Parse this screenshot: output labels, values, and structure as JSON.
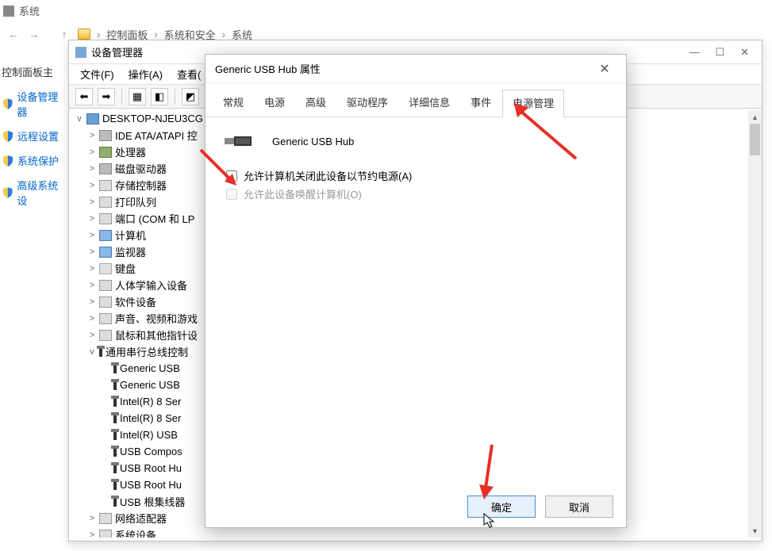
{
  "sys": {
    "title": "系统"
  },
  "breadcrumb": {
    "items": [
      "控制面板",
      "系统和安全",
      "系统"
    ]
  },
  "sidebar": {
    "items": [
      {
        "label": "控制面板主",
        "shield": false
      },
      {
        "label": "设备管理器",
        "shield": true
      },
      {
        "label": "远程设置",
        "shield": true
      },
      {
        "label": "系统保护",
        "shield": true
      },
      {
        "label": "高级系统设",
        "shield": true
      }
    ]
  },
  "devmgr": {
    "title": "设备管理器",
    "menu": [
      "文件(F)",
      "操作(A)",
      "查看("
    ],
    "root": "DESKTOP-NJEU3CG",
    "nodes": [
      {
        "label": "IDE ATA/ATAPI 控",
        "icon": "disk"
      },
      {
        "label": "处理器",
        "icon": "chip"
      },
      {
        "label": "磁盘驱动器",
        "icon": "disk"
      },
      {
        "label": "存储控制器",
        "icon": "card"
      },
      {
        "label": "打印队列",
        "icon": "card"
      },
      {
        "label": "端口 (COM 和 LP",
        "icon": "card"
      },
      {
        "label": "计算机",
        "icon": "mon"
      },
      {
        "label": "监视器",
        "icon": "mon"
      },
      {
        "label": "键盘",
        "icon": "kbd"
      },
      {
        "label": "人体学输入设备",
        "icon": "card"
      },
      {
        "label": "软件设备",
        "icon": "card"
      },
      {
        "label": "声音、视频和游戏",
        "icon": "card"
      },
      {
        "label": "鼠标和其他指针设",
        "icon": "card"
      },
      {
        "label": "通用串行总线控制",
        "icon": "usb",
        "expanded": true
      }
    ],
    "usb_children": [
      "Generic USB",
      "Generic USB",
      "Intel(R) 8 Ser",
      "Intel(R) 8 Ser",
      "Intel(R) USB",
      "USB Compos",
      "USB Root Hu",
      "USB Root Hu",
      "USB 根集线器"
    ],
    "tail": [
      {
        "label": "网络适配器",
        "icon": "card"
      },
      {
        "label": "系统设备",
        "icon": "card"
      }
    ]
  },
  "dlg": {
    "title": "Generic USB Hub 属性",
    "tabs": [
      "常规",
      "电源",
      "高级",
      "驱动程序",
      "详细信息",
      "事件",
      "电源管理"
    ],
    "active_tab": 6,
    "device": "Generic USB Hub",
    "opt1": "允许计算机关闭此设备以节约电源(A)",
    "opt2": "允许此设备唤醒计算机(O)",
    "ok": "确定",
    "cancel": "取消"
  }
}
